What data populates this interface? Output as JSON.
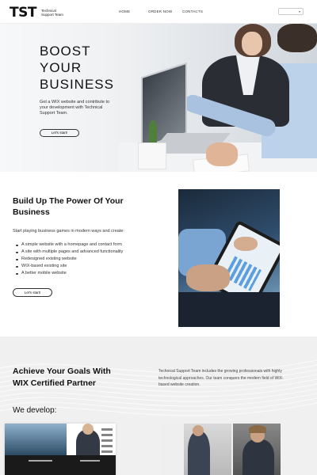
{
  "header": {
    "logo_mark": "TST",
    "logo_text": "Technical Support Team",
    "nav": [
      "HOME",
      "ORDER NOW",
      "CONTACTS"
    ],
    "language_selector": ""
  },
  "hero": {
    "title_lines": [
      "BOOST",
      "YOUR",
      "BUSINESS"
    ],
    "description": "Get a WIX website and contribute to your development with Technical Support Team.",
    "button": "Let's start!"
  },
  "section2": {
    "title": "Build Up The Power Of Your Business",
    "intro": "Start playing business games in modern ways and create:",
    "items": [
      "A simple website with a homepage and contact form",
      "A site with multiple pages and advanced functionality",
      "Redesigned existing website",
      "WIX-based existing site",
      "A better mobile website"
    ],
    "button": "Let's start!"
  },
  "section3": {
    "title": "Achieve Your Goals With WIX Certified Partner",
    "subtitle": "We develop:",
    "description": "Technical Support Team includes the growing professionals with highly technological approaches. Our team conquers the modern field of WIX-based website creation."
  }
}
